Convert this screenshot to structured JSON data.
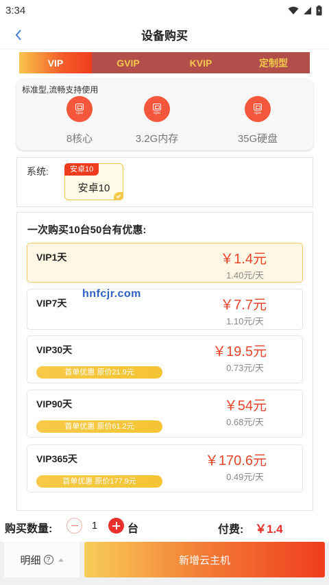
{
  "status_bar": {
    "time": "3:34"
  },
  "header": {
    "title": "设备购买"
  },
  "tabs": [
    {
      "label": "VIP",
      "active": true
    },
    {
      "label": "GVIP",
      "active": false
    },
    {
      "label": "KVIP",
      "active": false
    },
    {
      "label": "定制型",
      "active": false
    }
  ],
  "spec": {
    "description": "标准型,流畅支持使用",
    "items": [
      {
        "icon": "cpu-icon",
        "icon_text": "cpu",
        "value": "8核心"
      },
      {
        "icon": "cpu-icon",
        "icon_text": "cpu",
        "value": "3.2G内存"
      },
      {
        "icon": "cpu-icon",
        "icon_text": "cpu",
        "value": "35G硬盘"
      }
    ]
  },
  "system": {
    "label": "系统:",
    "options": [
      {
        "tag": "安卓10",
        "name": "安卓10",
        "selected": true
      }
    ]
  },
  "plans": {
    "title": "一次购买10台50台有优惠:",
    "items": [
      {
        "name": "VIP1天",
        "price": "￥1.4元",
        "unit_price": "1.40元/天",
        "badge": "",
        "selected": true
      },
      {
        "name": "VIP7天",
        "price": "￥7.7元",
        "unit_price": "1.10元/天",
        "badge": "",
        "selected": false
      },
      {
        "name": "VIP30天",
        "price": "￥19.5元",
        "unit_price": "0.73元/天",
        "badge": "首单优惠 原价21.9元",
        "selected": false
      },
      {
        "name": "VIP90天",
        "price": "￥54元",
        "unit_price": "0.68元/天",
        "badge": "首单优惠 原价61.2元",
        "selected": false
      },
      {
        "name": "VIP365天",
        "price": "￥170.6元",
        "unit_price": "0.49元/天",
        "badge": "首单优惠 原价177.9元",
        "selected": false
      }
    ]
  },
  "watermark": "hnfcjr.com",
  "quantity": {
    "label": "购买数量:",
    "value": "1",
    "unit": "台"
  },
  "fee": {
    "label": "付费:",
    "value": "￥1.4"
  },
  "footer": {
    "detail_label": "明细",
    "help_glyph": "?",
    "create_label": "新增云主机"
  },
  "colors": {
    "accent": "#e9302a",
    "brand_orange": "#f45a2a",
    "tab_bg": "#b34f4a",
    "badge_yellow": "#f5c433"
  }
}
